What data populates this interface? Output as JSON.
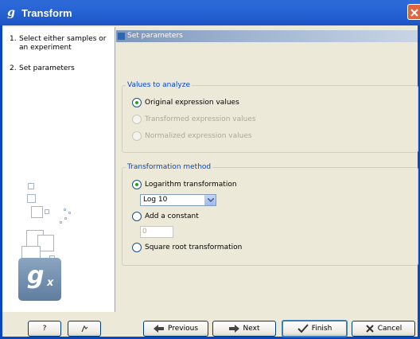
{
  "window": {
    "title": "Transform",
    "title_icon": "g-icon"
  },
  "steps": [
    {
      "number": "1.",
      "label": "Select either samples or an experiment"
    },
    {
      "number": "2.",
      "label": "Set parameters"
    }
  ],
  "logo": {
    "glyph": "g",
    "subscript": "x"
  },
  "section": {
    "title": "Set parameters"
  },
  "values_group": {
    "legend": "Values to analyze",
    "options": [
      {
        "label": "Original expression values",
        "checked": true,
        "enabled": true
      },
      {
        "label": "Transformed expression values",
        "checked": false,
        "enabled": false
      },
      {
        "label": "Normalized expression values",
        "checked": false,
        "enabled": false
      }
    ]
  },
  "method_group": {
    "legend": "Transformation method",
    "log_label": "Logarithm transformation",
    "log_select_value": "Log 10",
    "constant_label": "Add a constant",
    "constant_value": "0",
    "sqrt_label": "Square root transformation"
  },
  "footer": {
    "help_label": "?",
    "previous_label": "Previous",
    "next_label": "Next",
    "finish_label": "Finish",
    "cancel_label": "Cancel"
  },
  "colors": {
    "titlebar": "#2663d4",
    "legend_text": "#0046d5",
    "radio_dot": "#21a121"
  }
}
